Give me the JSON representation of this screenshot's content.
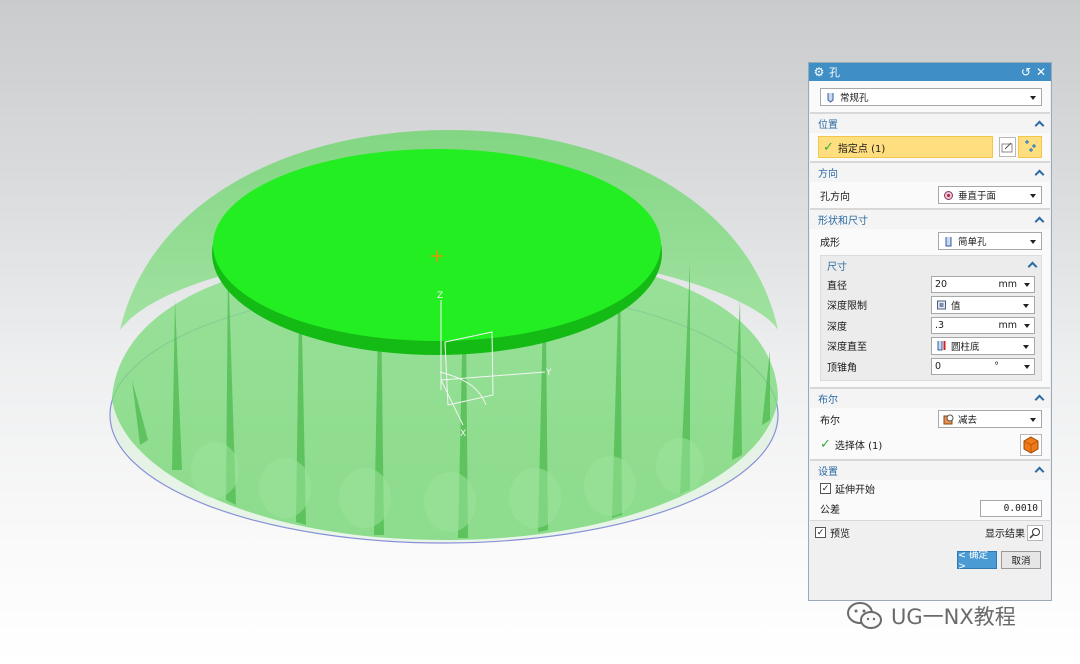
{
  "dialog": {
    "title": "孔",
    "hole_type": "常规孔",
    "sections": {
      "position": {
        "header": "位置",
        "point_label": "指定点 (1)"
      },
      "direction": {
        "header": "方向",
        "hole_dir_label": "孔方向",
        "hole_dir_value": "垂直于面"
      },
      "shape": {
        "header": "形状和尺寸",
        "form_label": "成形",
        "form_value": "简单孔",
        "dims": {
          "header": "尺寸",
          "diameter_label": "直径",
          "diameter_value": "20",
          "diameter_unit": "mm",
          "depth_limit_label": "深度限制",
          "depth_limit_value": "值",
          "depth_label": "深度",
          "depth_value": ".3",
          "depth_unit": "mm",
          "depth_to_label": "深度直至",
          "depth_to_value": "圆柱底",
          "tip_angle_label": "顶锥角",
          "tip_angle_value": "0",
          "tip_angle_unit": "°"
        }
      },
      "boolean": {
        "header": "布尔",
        "bool_label": "布尔",
        "bool_value": "减去",
        "body_label": "选择体 (1)"
      },
      "settings": {
        "header": "设置",
        "extend_start_label": "延伸开始",
        "tolerance_label": "公差",
        "tolerance_value": "0.0010"
      }
    },
    "preview_label": "预览",
    "show_result_label": "显示结果",
    "ok_label": "< 确定 >",
    "cancel_label": "取消"
  },
  "viewport": {
    "axis_z": "Z",
    "axis_y": "Y",
    "axis_x": "X"
  },
  "watermark": "UG一NX教程",
  "colors": {
    "accent": "#3f8fc6",
    "highlight": "#ffde80",
    "face_green": "#22ee22",
    "body_green": "#7fd97f"
  },
  "icons": {
    "hole_type": "hole-icon",
    "point": "point-constructor-icon",
    "direction": "normal-to-face-icon",
    "bool": "subtract-icon",
    "body": "solid-body-icon"
  }
}
